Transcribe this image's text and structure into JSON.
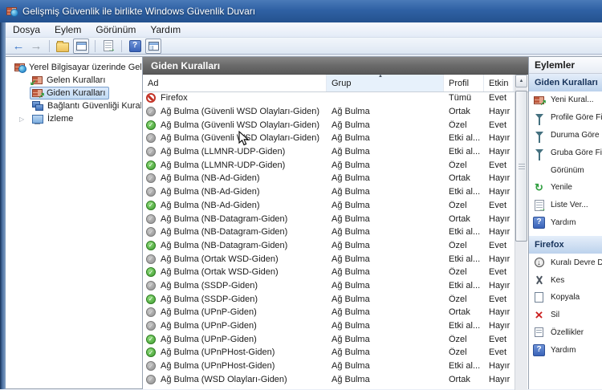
{
  "window": {
    "title": "Gelişmiş Güvenlik ile birlikte Windows Güvenlik Duvarı",
    "icon": "firewall-icon"
  },
  "menubar": {
    "items": [
      {
        "label": "Dosya"
      },
      {
        "label": "Eylem"
      },
      {
        "label": "Görünüm"
      },
      {
        "label": "Yardım"
      }
    ]
  },
  "toolbar": {
    "items": [
      {
        "type": "icon",
        "name": "back-arrow-icon"
      },
      {
        "type": "icon",
        "name": "forward-arrow-icon"
      },
      {
        "type": "sep"
      },
      {
        "type": "icon",
        "name": "up-folder-icon"
      },
      {
        "type": "icon",
        "name": "console-window-icon",
        "boxed": true
      },
      {
        "type": "sep"
      },
      {
        "type": "icon",
        "name": "export-list-icon"
      },
      {
        "type": "sep"
      },
      {
        "type": "icon",
        "name": "help-icon"
      },
      {
        "type": "icon",
        "name": "show-hide-tree-icon",
        "boxed": true
      }
    ]
  },
  "tree": {
    "root": {
      "label": "Yerel Bilgisayar üzerinde Gelişm",
      "icon": "firewall-root-icon"
    },
    "items": [
      {
        "label": "Gelen Kuralları",
        "icon": "inbound-rules-icon",
        "selected": false,
        "expandable": false
      },
      {
        "label": "Giden Kuralları",
        "icon": "outbound-rules-icon",
        "selected": true,
        "expandable": false
      },
      {
        "label": "Bağlantı Güvenliği Kuralları",
        "icon": "connection-security-icon",
        "selected": false,
        "expandable": false
      },
      {
        "label": "İzleme",
        "icon": "monitoring-icon",
        "selected": false,
        "expandable": true
      }
    ],
    "expander_glyph": "▷"
  },
  "list": {
    "title": "Giden Kuralları",
    "columns": [
      {
        "label": "Ad",
        "sorted": false
      },
      {
        "label": "Grup",
        "sorted": true,
        "sort_glyph": "▲"
      },
      {
        "label": "Profil",
        "sorted": false
      },
      {
        "label": "Etkin",
        "sorted": false
      }
    ],
    "rows": [
      {
        "name": "Firefox",
        "group": "",
        "profile": "Tümü",
        "enabled": "Evet",
        "state": "blocked"
      },
      {
        "name": "Ağ Bulma (Güvenli WSD Olayları-Giden)",
        "group": "Ağ Bulma",
        "profile": "Ortak",
        "enabled": "Hayır",
        "state": "off"
      },
      {
        "name": "Ağ Bulma (Güvenli WSD Olayları-Giden)",
        "group": "Ağ Bulma",
        "profile": "Özel",
        "enabled": "Evet",
        "state": "on"
      },
      {
        "name": "Ağ Bulma (Güvenli WSD Olayları-Giden)",
        "group": "Ağ Bulma",
        "profile": "Etki al...",
        "enabled": "Hayır",
        "state": "off"
      },
      {
        "name": "Ağ Bulma (LLMNR-UDP-Giden)",
        "group": "Ağ Bulma",
        "profile": "Etki al...",
        "enabled": "Hayır",
        "state": "off"
      },
      {
        "name": "Ağ Bulma (LLMNR-UDP-Giden)",
        "group": "Ağ Bulma",
        "profile": "Özel",
        "enabled": "Evet",
        "state": "on"
      },
      {
        "name": "Ağ Bulma (NB-Ad-Giden)",
        "group": "Ağ Bulma",
        "profile": "Ortak",
        "enabled": "Hayır",
        "state": "off"
      },
      {
        "name": "Ağ Bulma (NB-Ad-Giden)",
        "group": "Ağ Bulma",
        "profile": "Etki al...",
        "enabled": "Hayır",
        "state": "off"
      },
      {
        "name": "Ağ Bulma (NB-Ad-Giden)",
        "group": "Ağ Bulma",
        "profile": "Özel",
        "enabled": "Evet",
        "state": "on"
      },
      {
        "name": "Ağ Bulma (NB-Datagram-Giden)",
        "group": "Ağ Bulma",
        "profile": "Ortak",
        "enabled": "Hayır",
        "state": "off"
      },
      {
        "name": "Ağ Bulma (NB-Datagram-Giden)",
        "group": "Ağ Bulma",
        "profile": "Etki al...",
        "enabled": "Hayır",
        "state": "off"
      },
      {
        "name": "Ağ Bulma (NB-Datagram-Giden)",
        "group": "Ağ Bulma",
        "profile": "Özel",
        "enabled": "Evet",
        "state": "on"
      },
      {
        "name": "Ağ Bulma (Ortak WSD-Giden)",
        "group": "Ağ Bulma",
        "profile": "Etki al...",
        "enabled": "Hayır",
        "state": "off"
      },
      {
        "name": "Ağ Bulma (Ortak WSD-Giden)",
        "group": "Ağ Bulma",
        "profile": "Özel",
        "enabled": "Evet",
        "state": "on"
      },
      {
        "name": "Ağ Bulma (SSDP-Giden)",
        "group": "Ağ Bulma",
        "profile": "Etki al...",
        "enabled": "Hayır",
        "state": "off"
      },
      {
        "name": "Ağ Bulma (SSDP-Giden)",
        "group": "Ağ Bulma",
        "profile": "Özel",
        "enabled": "Evet",
        "state": "on"
      },
      {
        "name": "Ağ Bulma (UPnP-Giden)",
        "group": "Ağ Bulma",
        "profile": "Ortak",
        "enabled": "Hayır",
        "state": "off"
      },
      {
        "name": "Ağ Bulma (UPnP-Giden)",
        "group": "Ağ Bulma",
        "profile": "Etki al...",
        "enabled": "Hayır",
        "state": "off"
      },
      {
        "name": "Ağ Bulma (UPnP-Giden)",
        "group": "Ağ Bulma",
        "profile": "Özel",
        "enabled": "Evet",
        "state": "on"
      },
      {
        "name": "Ağ Bulma (UPnPHost-Giden)",
        "group": "Ağ Bulma",
        "profile": "Özel",
        "enabled": "Evet",
        "state": "on"
      },
      {
        "name": "Ağ Bulma (UPnPHost-Giden)",
        "group": "Ağ Bulma",
        "profile": "Etki al...",
        "enabled": "Hayır",
        "state": "off"
      },
      {
        "name": "Ağ Bulma (WSD Olayları-Giden)",
        "group": "Ağ Bulma",
        "profile": "Ortak",
        "enabled": "Hayır",
        "state": "off"
      }
    ]
  },
  "actions": {
    "title": "Eylemler",
    "sections": [
      {
        "header": "Giden Kuralları",
        "items": [
          {
            "label": "Yeni Kural...",
            "icon": "new-rule-icon"
          },
          {
            "label": "Profile Göre Fil",
            "icon": "filter-icon"
          },
          {
            "label": "Duruma Göre Fi",
            "icon": "filter-icon"
          },
          {
            "label": "Gruba Göre Fil",
            "icon": "filter-icon"
          },
          {
            "label": "Görünüm",
            "icon": "none"
          },
          {
            "label": "Yenile",
            "icon": "refresh-icon"
          },
          {
            "label": "Liste Ver...",
            "icon": "export-list-icon"
          },
          {
            "label": "Yardım",
            "icon": "help-icon"
          }
        ]
      },
      {
        "header": "Firefox",
        "items": [
          {
            "label": "Kuralı Devre Dı",
            "icon": "disable-rule-icon"
          },
          {
            "label": "Kes",
            "icon": "cut-icon"
          },
          {
            "label": "Kopyala",
            "icon": "copy-icon"
          },
          {
            "label": "Sil",
            "icon": "delete-icon"
          },
          {
            "label": "Özellikler",
            "icon": "properties-icon"
          },
          {
            "label": "Yardım",
            "icon": "help-icon"
          }
        ]
      }
    ]
  },
  "scrollbar": {
    "up_glyph": "▲"
  },
  "colors": {
    "titlebar_blue": "#2f61a4",
    "panel_header_gray": "#6a6a6a",
    "selection_blue": "#c2dbf4",
    "enabled_green": "#3f9e2f",
    "disabled_gray": "#8f8f8f",
    "blocked_red": "#c33327",
    "actions_header_blue": "#bcd2ec"
  }
}
